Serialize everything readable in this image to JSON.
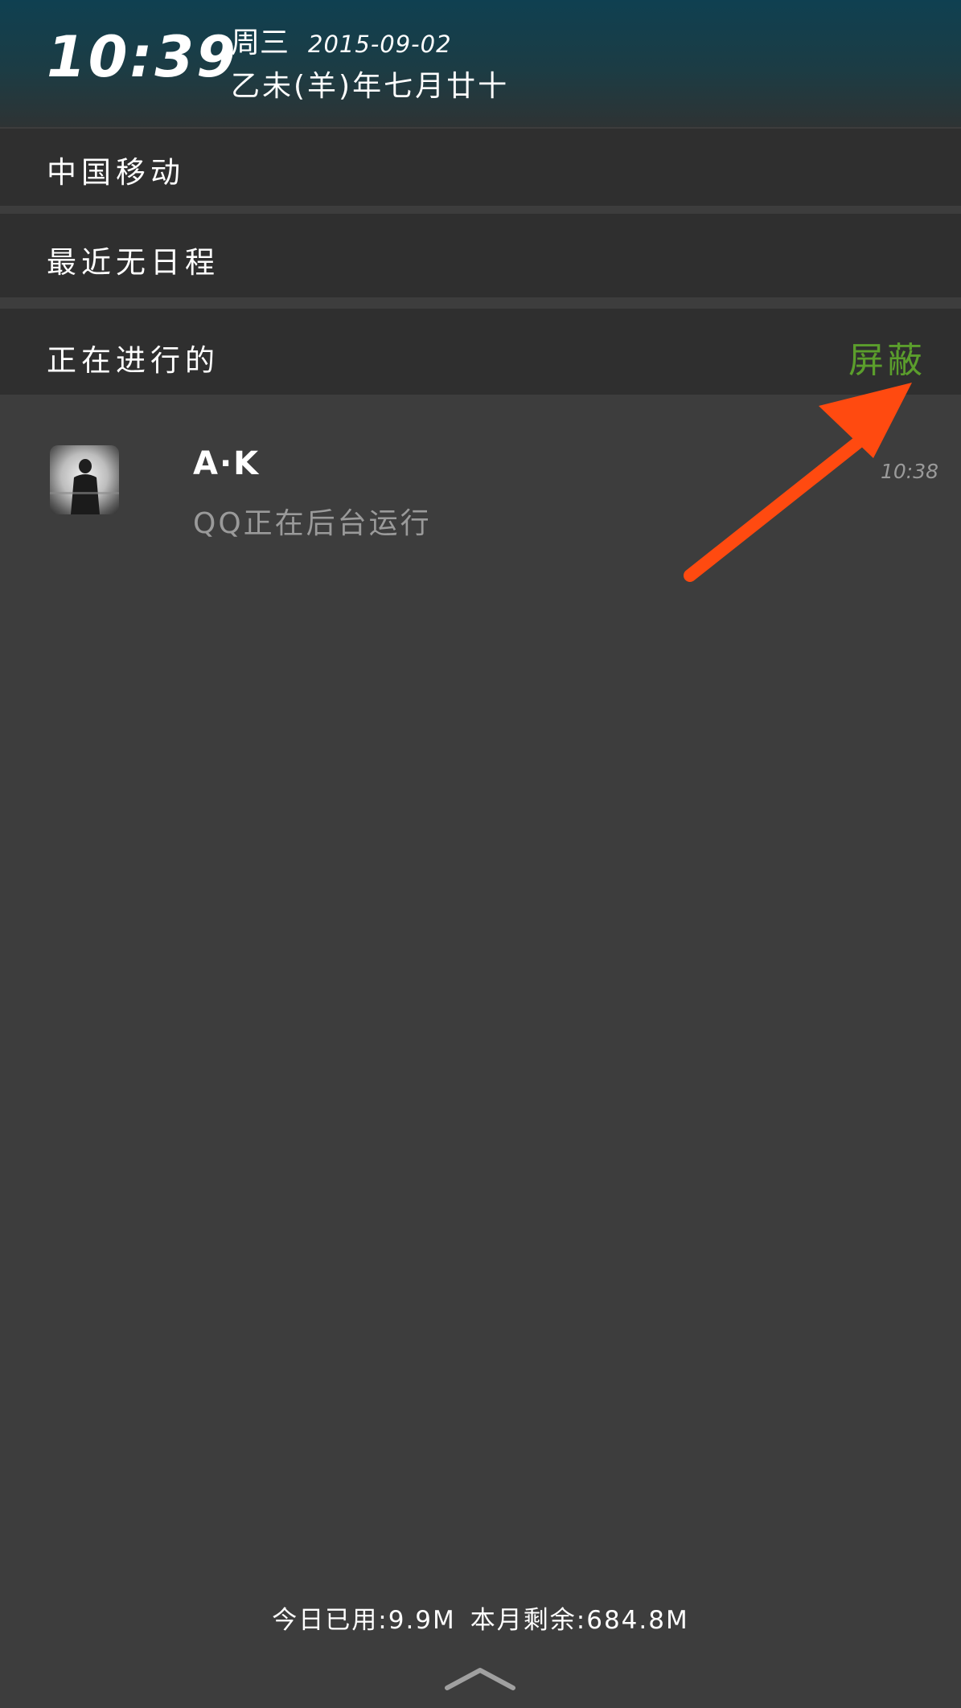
{
  "header": {
    "time": "10:39",
    "weekday": "周三",
    "date": "2015-09-02",
    "lunar_date": "乙未(羊)年七月廿十"
  },
  "carrier": {
    "name": "中国移动"
  },
  "schedule": {
    "text": "最近无日程"
  },
  "ongoing": {
    "title": "正在进行的",
    "block_label": "屏蔽"
  },
  "notification": {
    "title": "A·K",
    "subtitle": "QQ正在后台运行",
    "time": "10:38"
  },
  "footer": {
    "today_used": "今日已用:9.9M",
    "month_remaining": "本月剩余:684.8M"
  },
  "colors": {
    "block_label": "#5b9e2c",
    "annotation_arrow": "#ff4a10",
    "background": "#3d3d3d",
    "section_row": "#2f2f2f"
  },
  "icons": {
    "expand": "chevron-up-icon",
    "arrow": "annotation-arrow-icon"
  }
}
